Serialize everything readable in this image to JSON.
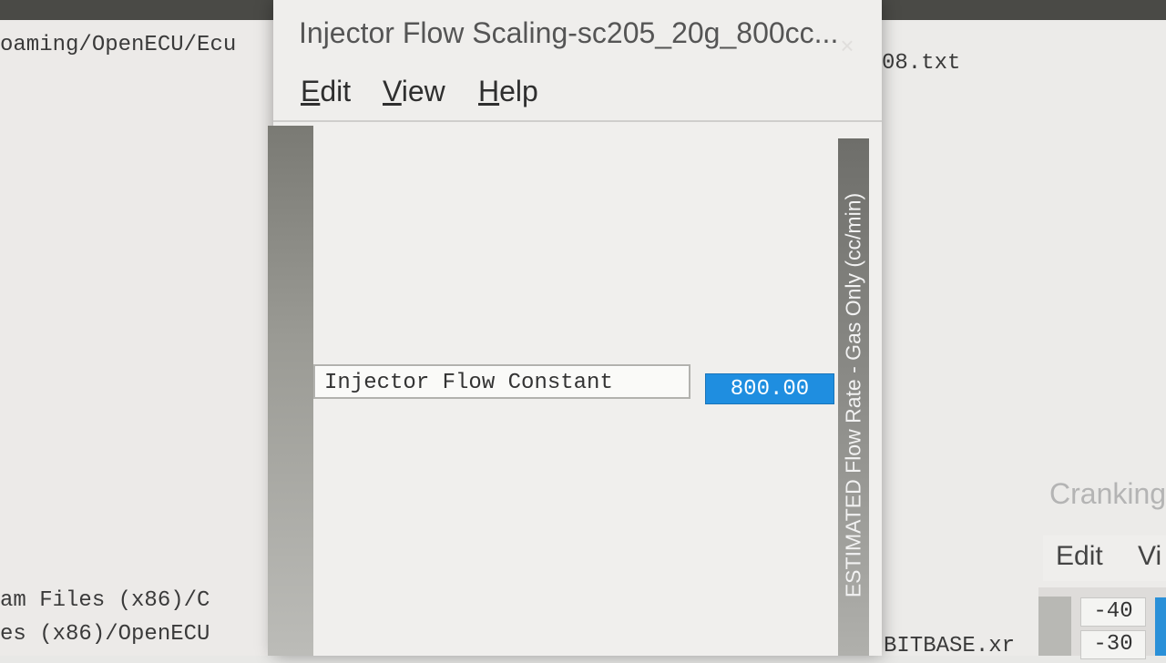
{
  "background": {
    "left_path_top": "oaming/OpenECU/Ecu",
    "left_path_bottom_1": "am Files (x86)/C",
    "left_path_bottom_2": "es (x86)/OpenECU",
    "right_filename": "08.txt",
    "right_bottom_file": "BITBASE.xr",
    "second_window": {
      "title": "Cranking",
      "menu": [
        "Edit",
        "Vi"
      ],
      "cells": [
        "-40",
        "-30"
      ]
    }
  },
  "dialog": {
    "title": "Injector Flow Scaling-sc205_20g_800cc...",
    "close_icon": "×",
    "menu": [
      {
        "label": "Edit",
        "mnemonic": "E"
      },
      {
        "label": "View",
        "mnemonic": "V"
      },
      {
        "label": "Help",
        "mnemonic": "H"
      }
    ],
    "axis_label": "ESTIMATED Flow Rate - Gas Only (cc/min)",
    "parameter": {
      "label": "Injector Flow Constant",
      "value": "800.00"
    }
  },
  "colors": {
    "value_highlight": "#1f8ee0",
    "dialog_bg": "#efeeec"
  }
}
